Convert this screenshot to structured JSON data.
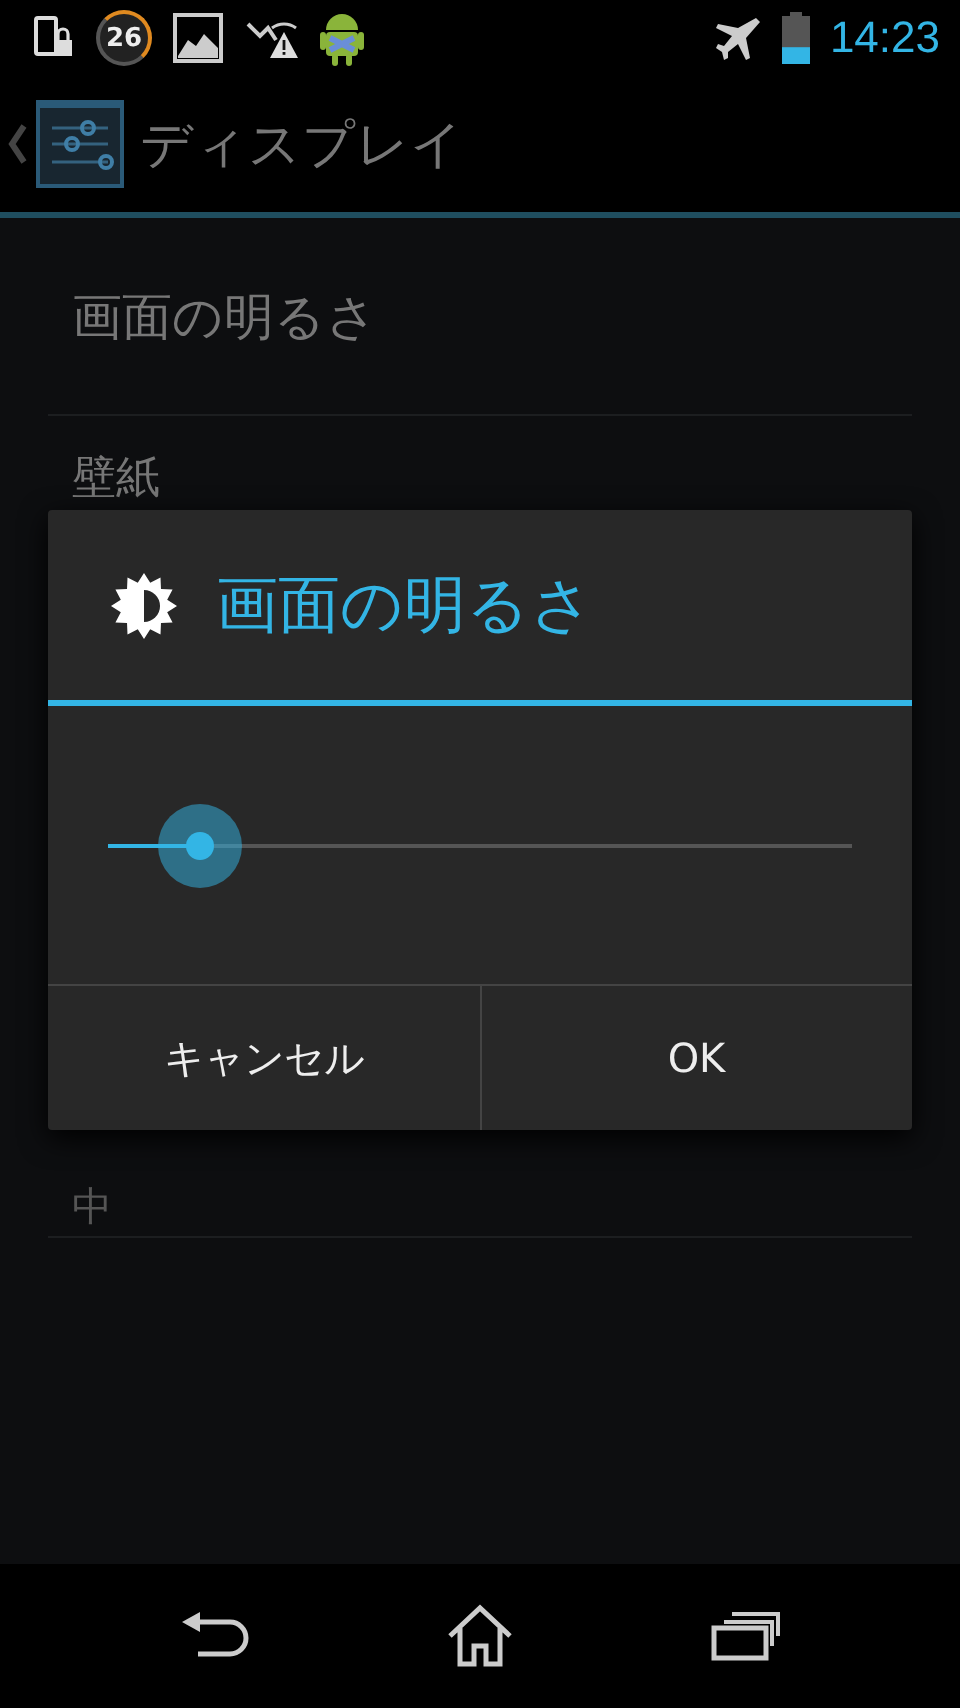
{
  "status_bar": {
    "badge": "26",
    "time": "14:23"
  },
  "action_bar": {
    "title": "ディスプレイ"
  },
  "settings": [
    {
      "title": "画面の明るさ"
    },
    {
      "title": "壁紙"
    },
    {
      "summary": "中"
    }
  ],
  "dialog": {
    "title": "画面の明るさ",
    "slider": {
      "level": 0.11
    },
    "buttons": [
      {
        "label": "キャンセル"
      },
      {
        "label": "OK"
      }
    ]
  }
}
